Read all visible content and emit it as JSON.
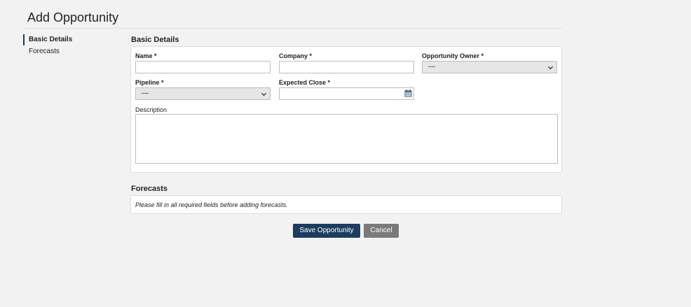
{
  "page": {
    "title": "Add Opportunity"
  },
  "side_nav": {
    "items": [
      {
        "label": "Basic Details",
        "active": true
      },
      {
        "label": "Forecasts",
        "active": false
      }
    ]
  },
  "basic_details": {
    "heading": "Basic Details",
    "name": {
      "label": "Name *",
      "value": ""
    },
    "company": {
      "label": "Company *",
      "value": ""
    },
    "owner": {
      "label": "Opportunity Owner *",
      "selected": "—"
    },
    "pipeline": {
      "label": "Pipeline *",
      "selected": "—"
    },
    "expected_close": {
      "label": "Expected Close *",
      "value": ""
    },
    "description": {
      "label": "Description",
      "value": ""
    }
  },
  "forecasts": {
    "heading": "Forecasts",
    "message": "Please fill in all required fields before adding forecasts."
  },
  "actions": {
    "save_label": "Save Opportunity",
    "cancel_label": "Cancel"
  },
  "colors": {
    "save_button": "#1c3d5e",
    "cancel_button": "#7a7a7a",
    "background": "#f2f2f2"
  }
}
